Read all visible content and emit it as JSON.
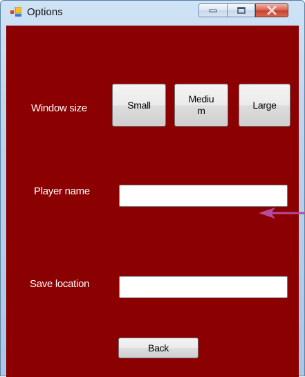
{
  "window": {
    "title": "Options",
    "controls": {
      "minimize": "minimize-icon",
      "maximize": "maximize-icon",
      "close": "close-icon"
    }
  },
  "options": {
    "window_size_label": "Window size",
    "size_buttons": {
      "small": "Small",
      "medium": "Mediu\nm",
      "large": "Large"
    },
    "player_name_label": "Player name",
    "player_name_value": "",
    "save_location_label": "Save location",
    "save_location_value": "",
    "back_button": "Back"
  },
  "colors": {
    "client_background": "#8b0000",
    "annotation_arrow": "#b44c9e"
  }
}
